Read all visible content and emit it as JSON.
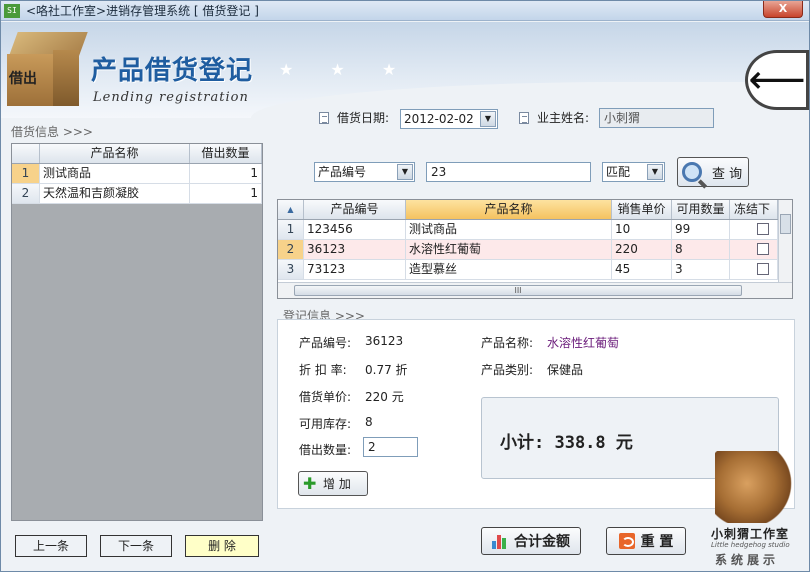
{
  "window": {
    "title": "<咯社工作室>进销存管理系统 [ 借货登记 ]",
    "app_icon": "SI",
    "close_label": "X"
  },
  "header": {
    "logo_label": "借出",
    "title": "产品借货登记",
    "stars": "★ ★ ★",
    "subtitle": "Lending registration",
    "back_icon": "back-arrow-icon"
  },
  "left": {
    "section_label": "借货信息 >>>",
    "columns": [
      "产品名称",
      "借出数量"
    ],
    "rows": [
      {
        "num": "1",
        "name": "测试商品",
        "qty": "1"
      },
      {
        "num": "2",
        "name": "天然温和吉颜凝胶",
        "qty": "1"
      }
    ],
    "prev_label": "上一条",
    "next_label": "下一条",
    "delete_label": "删 除"
  },
  "form": {
    "date_label": "借货日期:",
    "date_value": "2012-02-02",
    "owner_label": "业主姓名:",
    "owner_value": "小刺猬",
    "search_field": "产品编号",
    "search_value": "23",
    "match_mode": "匹配",
    "search_label": "查  询"
  },
  "products": {
    "columns": [
      "产品编号",
      "产品名称",
      "销售单价",
      "可用数量",
      "冻结下"
    ],
    "rows": [
      {
        "num": "1",
        "code": "123456",
        "name": "测试商品",
        "price": "10",
        "qty": "99"
      },
      {
        "num": "2",
        "code": "36123",
        "name": "水溶性红葡萄",
        "price": "220",
        "qty": "8"
      },
      {
        "num": "3",
        "code": "73123",
        "name": "造型慕丝",
        "price": "45",
        "qty": "3"
      }
    ],
    "scroll_grip": "III"
  },
  "register": {
    "section_label": "登记信息 >>>",
    "code_label": "产品编号:",
    "code_value": "36123",
    "name_label": "产品名称:",
    "name_value": "水溶性红葡萄",
    "discount_label": "折 扣 率:",
    "discount_value": "0.77 折",
    "category_label": "产品类别:",
    "category_value": "保健品",
    "price_label": "借货单价:",
    "price_value": "220 元",
    "stock_label": "可用库存:",
    "stock_value": "8",
    "qty_label": "借出数量:",
    "qty_value": "2",
    "add_label": "增  加",
    "subtotal": "小计: 338.8 元"
  },
  "footer": {
    "total_label": "合计金额",
    "reset_label": "重  置"
  },
  "watermark": {
    "cn": "小刺猬工作室",
    "en": "Little hedgehog studio",
    "show": "系统展示"
  }
}
